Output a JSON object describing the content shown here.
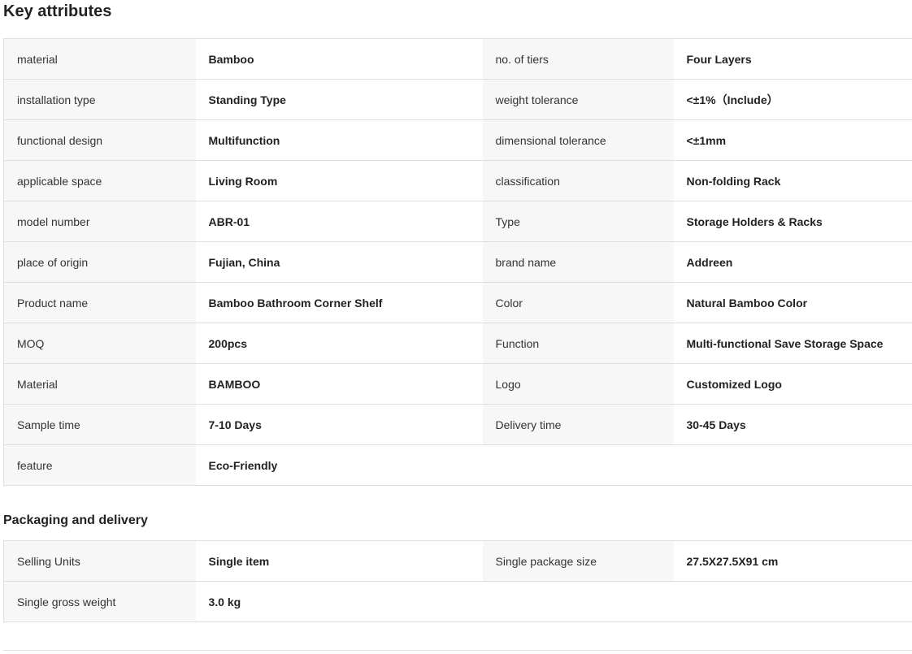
{
  "key_attributes": {
    "title": "Key attributes",
    "rows": [
      {
        "k1": "material",
        "v1": "Bamboo",
        "k2": "no. of tiers",
        "v2": "Four Layers"
      },
      {
        "k1": "installation type",
        "v1": "Standing Type",
        "k2": "weight tolerance",
        "v2": "<±1%（Include）"
      },
      {
        "k1": "functional design",
        "v1": "Multifunction",
        "k2": "dimensional tolerance",
        "v2": "<±1mm"
      },
      {
        "k1": "applicable space",
        "v1": "Living Room",
        "k2": "classification",
        "v2": "Non-folding Rack"
      },
      {
        "k1": "model number",
        "v1": "ABR-01",
        "k2": "Type",
        "v2": "Storage Holders & Racks"
      },
      {
        "k1": "place of origin",
        "v1": "Fujian, China",
        "k2": "brand name",
        "v2": "Addreen"
      },
      {
        "k1": "Product name",
        "v1": "Bamboo Bathroom Corner Shelf",
        "k2": "Color",
        "v2": "Natural Bamboo Color"
      },
      {
        "k1": "MOQ",
        "v1": "200pcs",
        "k2": "Function",
        "v2": "Multi-functional Save Storage Space"
      },
      {
        "k1": "Material",
        "v1": "BAMBOO",
        "k2": "Logo",
        "v2": "Customized Logo"
      },
      {
        "k1": "Sample time",
        "v1": "7-10 Days",
        "k2": "Delivery time",
        "v2": "30-45 Days"
      },
      {
        "k1": "feature",
        "v1": "Eco-Friendly",
        "k2": "",
        "v2": ""
      }
    ]
  },
  "packaging_delivery": {
    "title": "Packaging and delivery",
    "rows": [
      {
        "k1": "Selling Units",
        "v1": "Single item",
        "k2": "Single package size",
        "v2": "27.5X27.5X91 cm"
      },
      {
        "k1": "Single gross weight",
        "v1": "3.0 kg",
        "k2": "",
        "v2": ""
      }
    ]
  },
  "colors": {
    "key_cell_bg": "#f7f7f7",
    "value_cell_bg": "#ffffff",
    "border": "#e0e0e0",
    "text": "#222222"
  }
}
